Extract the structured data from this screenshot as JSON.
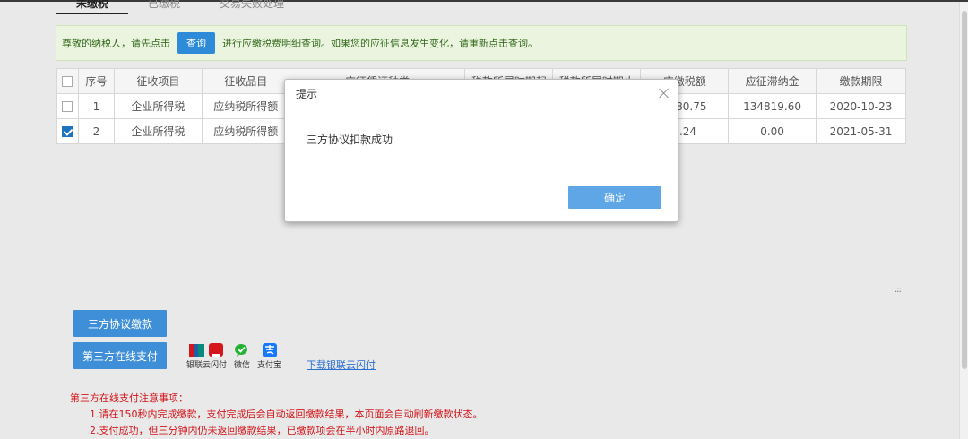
{
  "tabs": [
    {
      "label": "未缴税"
    },
    {
      "label": "已缴税"
    },
    {
      "label": "交易失败处理"
    }
  ],
  "notice": {
    "prefix": "尊敬的纳税人，请先点击",
    "query_button": "查询",
    "suffix": "进行应缴税费明细查询。如果您的应征信息发生变化，请重新点击查询。"
  },
  "table": {
    "headers": [
      "序号",
      "征收项目",
      "征收品目",
      "应征凭证种类",
      "税款所属时期起",
      "税款所属时期止",
      "应缴税额",
      "应征滞纳金",
      "缴款期限"
    ],
    "rows": [
      {
        "checked": false,
        "seq": "1",
        "item": "企业所得税",
        "category": "应纳税所得额",
        "tax": "9580.75",
        "late_fee": "134819.60",
        "deadline": "2020-10-23"
      },
      {
        "checked": true,
        "seq": "2",
        "item": "企业所得税",
        "category": "应纳税所得额",
        "tax": "1.24",
        "late_fee": "0.00",
        "deadline": "2021-05-31"
      }
    ]
  },
  "buttons": {
    "agreement_pay": "三方协议缴款",
    "online_pay": "第三方在线支付"
  },
  "pay_methods": [
    {
      "label": "银联云闪付",
      "icon": "unionpay-icon",
      "color": "#d4161c"
    },
    {
      "label": "微信",
      "icon": "wechat-icon",
      "color": "#23b232"
    },
    {
      "label": "支付宝",
      "icon": "alipay-icon",
      "color": "#1677ff"
    }
  ],
  "download_link": "下载银联云闪付",
  "notes": {
    "title": "第三方在线支付注意事项：",
    "lines": [
      "1.请在150秒内完成缴款，支付完成后会自动返回缴款结果，本页面会自动刷新缴款状态。",
      "2.支付成功，但三分钟内仍未返回缴款结果，已缴款项会在半小时内原路退回。"
    ]
  },
  "dialog": {
    "title": "提示",
    "message": "三方协议扣款成功",
    "ok_label": "确定"
  },
  "colors": {
    "accent": "#3f8fd8",
    "notice_bg": "#eaf4df",
    "warning": "#d4161c"
  }
}
